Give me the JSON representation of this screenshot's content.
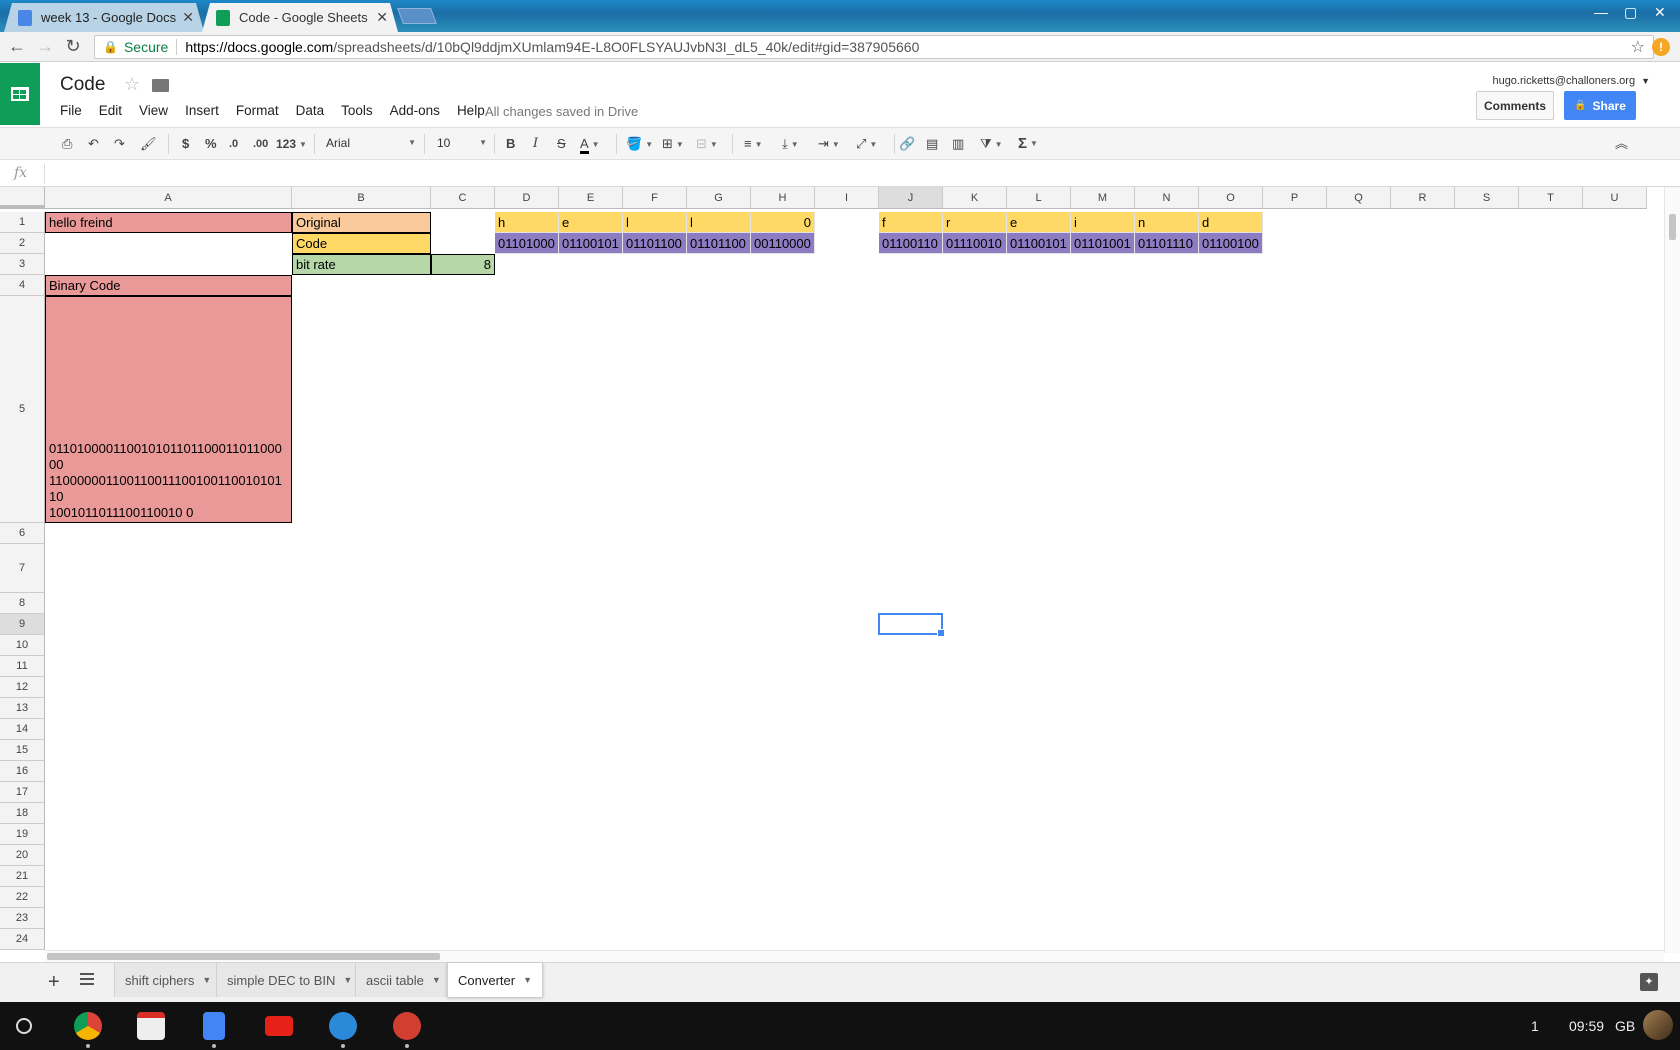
{
  "browser": {
    "tabs": [
      {
        "title": "week 13 - Google Docs",
        "icon_color": "#4a86e8"
      },
      {
        "title": "Code - Google Sheets",
        "icon_color": "#0f9d58"
      }
    ],
    "secure_label": "Secure",
    "url_host": "https://docs.google.com",
    "url_path": "/spreadsheets/d/10bQl9ddjmXUmlam94E-L8O0FLSYAUJvbN3I_dL5_40k/edit#gid=387905660",
    "nav_icons": [
      "back-icon",
      "forward-icon",
      "reload-icon"
    ],
    "ext_badge": "!"
  },
  "doc": {
    "title": "Code",
    "status": "All changes saved in Drive",
    "account": "hugo.ricketts@challoners.org",
    "menu": [
      "File",
      "Edit",
      "View",
      "Insert",
      "Format",
      "Data",
      "Tools",
      "Add-ons",
      "Help"
    ],
    "comments_label": "Comments",
    "share_label": "Share"
  },
  "toolbar": {
    "currency": "$",
    "percent": "%",
    "dec_less": ".0",
    "dec_more": ".00",
    "number_format": "123",
    "font": "Arial",
    "font_size": "10",
    "bold": "B",
    "italic": "I",
    "strike": "S",
    "text_color": "A",
    "sum": "Σ"
  },
  "formula": {
    "fx": "fx",
    "value": ""
  },
  "columns": [
    "A",
    "B",
    "C",
    "D",
    "E",
    "F",
    "G",
    "H",
    "I",
    "J",
    "K",
    "L",
    "M",
    "N",
    "O",
    "P",
    "Q",
    "R",
    "S",
    "T",
    "U"
  ],
  "rows": [
    "1",
    "2",
    "3",
    "4",
    "5",
    "6",
    "7",
    "8",
    "9",
    "10",
    "11",
    "12",
    "13",
    "14",
    "15",
    "16",
    "17",
    "18",
    "19",
    "20",
    "21",
    "22",
    "23",
    "24"
  ],
  "cells": {
    "A1": "hello freind",
    "B1": "Original",
    "B2": "Code",
    "B3": "bit rate",
    "C3": "8",
    "A4": "Binary Code",
    "A5": "0110100001100101011011000110110000110000001100110011100100110010101101001011011100110010 0",
    "D1": "h",
    "E1": "e",
    "F1": "l",
    "G1": "l",
    "H1": "0",
    "J1": "f",
    "K1": "r",
    "L1": "e",
    "M1": "i",
    "N1": "n",
    "O1": "d",
    "D2": "01101000",
    "E2": "01100101",
    "F2": "01101100",
    "G2": "01101100",
    "H2": "00110000",
    "J2": "01100110",
    "K2": "01110010",
    "L2": "01100101",
    "M2": "01101001",
    "N2": "01101110",
    "O2": "01100100"
  },
  "a5_lines": [
    "01101000011001010110110001101100000",
    "11000000110011001110010011001010110",
    "1001011011100110010 0"
  ],
  "colors": {
    "pink": "#ea9999",
    "peach": "#f9cb9c",
    "yellow": "#ffd966",
    "green": "#b6d7a8",
    "purple": "#8e7cc3",
    "selection": "#4285f4"
  },
  "sheets": [
    {
      "name": "shift ciphers",
      "active": false
    },
    {
      "name": "simple DEC to BIN",
      "active": false
    },
    {
      "name": "ascii table",
      "active": false
    },
    {
      "name": "Converter",
      "active": true
    }
  ],
  "taskbar": {
    "apps": [
      "chrome-icon",
      "gmail-icon",
      "docs-icon",
      "youtube-icon",
      "files-icon",
      "photos-icon"
    ],
    "notification_count": "1",
    "time": "09:59",
    "locale": "GB"
  }
}
